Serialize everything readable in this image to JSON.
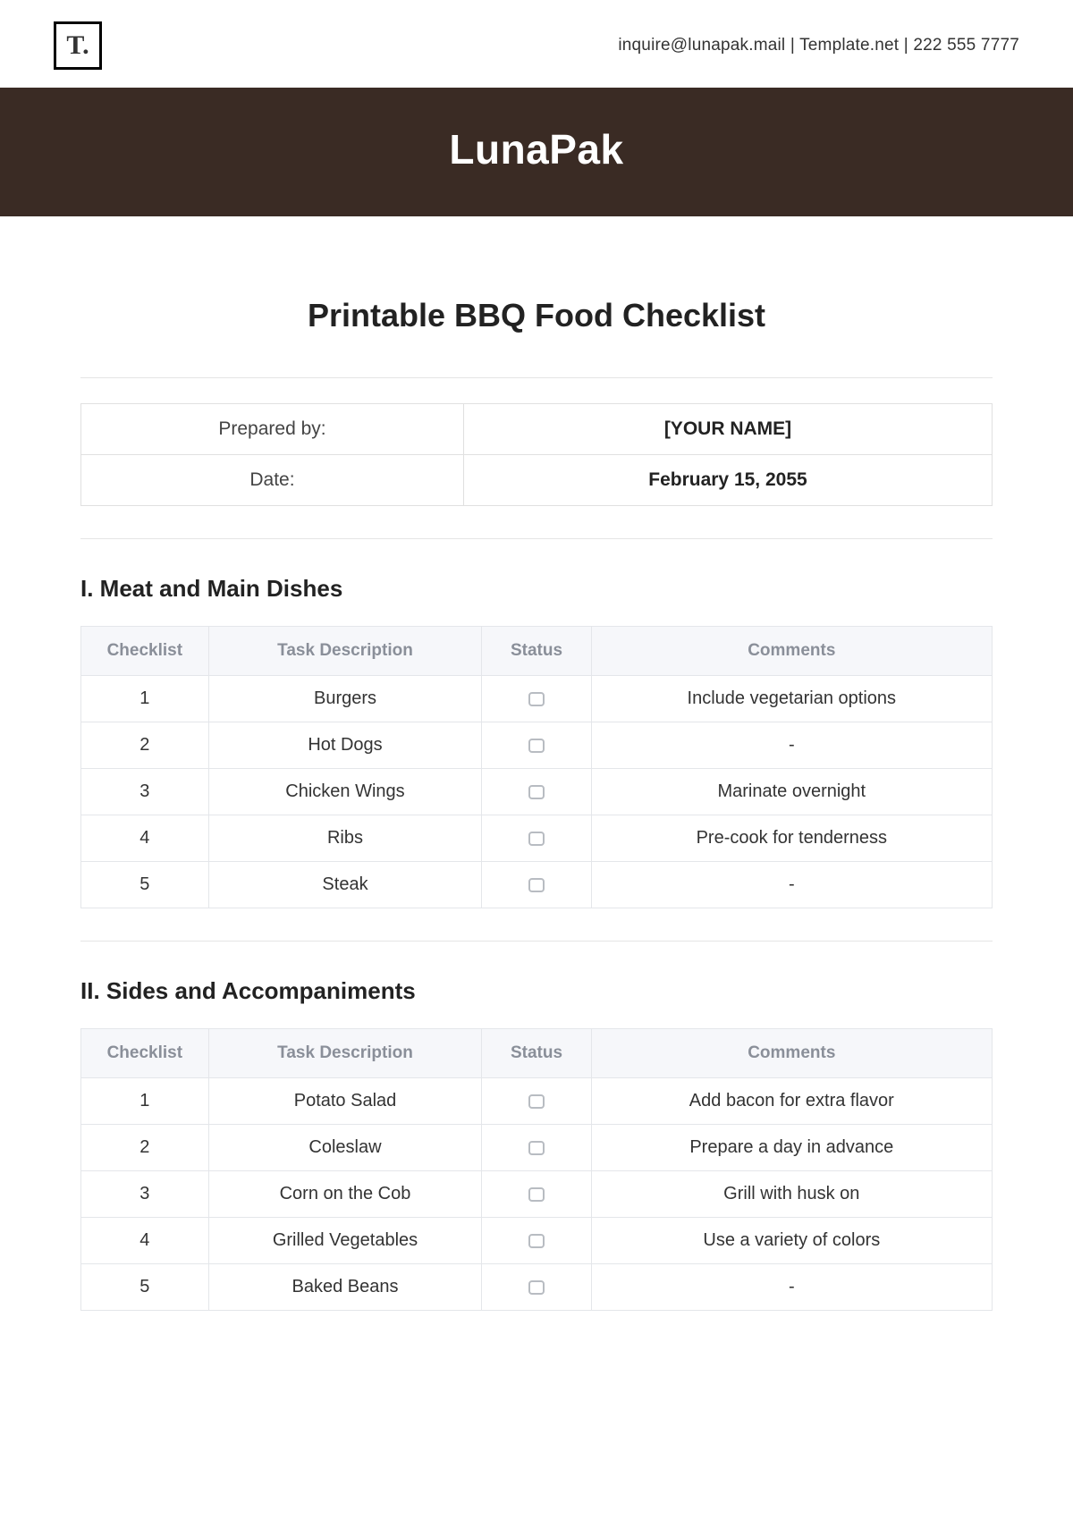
{
  "header": {
    "logo_text": "T.",
    "contact": "inquire@lunapak.mail  |  Template.net  |  222 555 7777"
  },
  "banner": {
    "brand": "LunaPak"
  },
  "title": "Printable BBQ Food Checklist",
  "meta": {
    "prepared_label": "Prepared by:",
    "prepared_value": "[YOUR NAME]",
    "date_label": "Date:",
    "date_value": "February 15, 2055"
  },
  "columns": {
    "checklist": "Checklist",
    "task": "Task Description",
    "status": "Status",
    "comments": "Comments"
  },
  "sections": [
    {
      "heading": "I. Meat and Main Dishes",
      "rows": [
        {
          "idx": "1",
          "task": "Burgers",
          "comment": "Include vegetarian options"
        },
        {
          "idx": "2",
          "task": "Hot Dogs",
          "comment": "-"
        },
        {
          "idx": "3",
          "task": "Chicken Wings",
          "comment": "Marinate overnight"
        },
        {
          "idx": "4",
          "task": "Ribs",
          "comment": "Pre-cook for tenderness"
        },
        {
          "idx": "5",
          "task": "Steak",
          "comment": "-"
        }
      ]
    },
    {
      "heading": "II. Sides and Accompaniments",
      "rows": [
        {
          "idx": "1",
          "task": "Potato Salad",
          "comment": "Add bacon for extra flavor"
        },
        {
          "idx": "2",
          "task": "Coleslaw",
          "comment": "Prepare a day in advance"
        },
        {
          "idx": "3",
          "task": "Corn on the Cob",
          "comment": "Grill with husk on"
        },
        {
          "idx": "4",
          "task": "Grilled Vegetables",
          "comment": "Use a variety of colors"
        },
        {
          "idx": "5",
          "task": "Baked Beans",
          "comment": "-"
        }
      ]
    }
  ]
}
